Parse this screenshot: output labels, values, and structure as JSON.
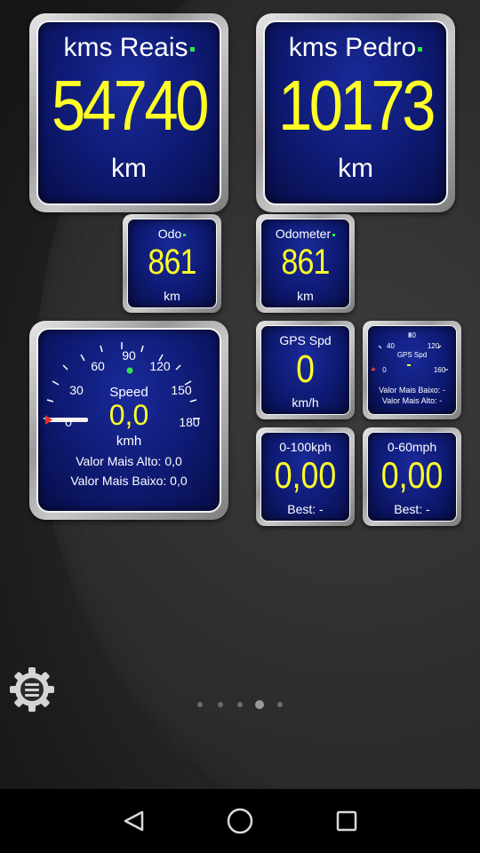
{
  "tiles": {
    "kms_reais": {
      "label": "kms Reais",
      "value": "54740",
      "unit": "km"
    },
    "kms_pedro": {
      "label": "kms Pedro",
      "value": "10173",
      "unit": "km"
    },
    "odo": {
      "label": "Odo",
      "value": "861",
      "unit": "km"
    },
    "odometer": {
      "label": "Odometer",
      "value": "861",
      "unit": "km"
    },
    "gps_spd": {
      "label": "GPS Spd",
      "value": "0",
      "unit": "km/h"
    },
    "accel_kph": {
      "label": "0-100kph",
      "value": "0,00",
      "best": "Best: -"
    },
    "accel_mph": {
      "label": "0-60mph",
      "value": "0,00",
      "best": "Best: -"
    }
  },
  "speed_gauge": {
    "label": "Speed",
    "value": "0,0",
    "unit": "kmh",
    "high": "Valor Mais Alto: 0,0",
    "low": "Valor Mais Baixo: 0,0",
    "ticks": [
      "0",
      "30",
      "60",
      "90",
      "120",
      "150",
      "180"
    ]
  },
  "gps_gauge": {
    "label": "GPS Spd",
    "ticks": [
      "0",
      "40",
      "80",
      "120",
      "160"
    ],
    "low": "Valor Mais Baixo: -",
    "high": "Valor Mais Alto: -"
  },
  "pager": {
    "pages": 5,
    "active_index": 3
  },
  "icons": {
    "settings": "gear-menu-icon",
    "back": "back-triangle-icon",
    "home": "home-circle-icon",
    "recents": "recents-square-icon"
  },
  "colors": {
    "value_yellow": "#ffff26",
    "face_blue": "#0e1a72",
    "indicator_green": "#2ee84a",
    "needle_red": "#e83030"
  }
}
